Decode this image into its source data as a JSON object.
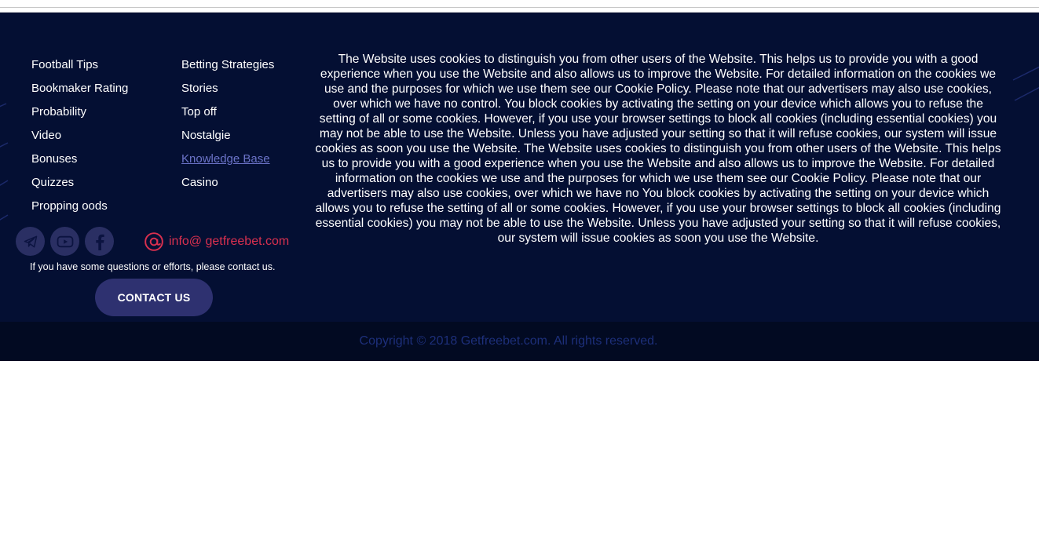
{
  "footer": {
    "links_col1": [
      {
        "label": "Football Tips"
      },
      {
        "label": "Bookmaker Rating"
      },
      {
        "label": "Probability"
      },
      {
        "label": "Video"
      },
      {
        "label": "Bonuses"
      },
      {
        "label": "Quizzes"
      },
      {
        "label": "Propping oods"
      }
    ],
    "links_col2": [
      {
        "label": "Betting Strategies"
      },
      {
        "label": "Stories"
      },
      {
        "label": "Top off"
      },
      {
        "label": "Nostalgie"
      },
      {
        "label": "Knowledge Base",
        "style": "link"
      },
      {
        "label": "Casino"
      }
    ],
    "socials": [
      {
        "icon": "telegram-icon"
      },
      {
        "icon": "youtube-icon"
      },
      {
        "icon": "facebook-icon"
      }
    ],
    "email": {
      "icon": "at-sign-icon",
      "text": "info@ getfreebet.com"
    },
    "contact_text": "If you have some questions or efforts, please contact us.",
    "contact_button": "CONTACT US",
    "cookie_text": "The Website uses cookies to distinguish you from other users of the Website. This helps us to provide you with a good experience when you use the Website and also allows us to improve the Website. For detailed information on the cookies we use and the purposes for which we use them see our Cookie Policy. Please note that our advertisers may also use cookies, over which we have no control. You block cookies by activating the setting on your device which allows you to refuse the setting of all or some cookies. However, if you use your browser settings to block all cookies (including essential cookies) you may not be able to use the Website. Unless you have adjusted your setting so that it will refuse cookies, our system will issue cookies as soon you use the Website. The Website uses cookies to distinguish you from other users of the Website. This helps us to provide you with a good experience when you use the Website and also allows us to improve the Website. For detailed information on the cookies we use and the purposes for which we use them see our Cookie Policy. Please note that our advertisers may also use cookies, over which we have no You block cookies by activating the setting on your device which allows you to refuse the setting of all or some cookies. However, if you use your browser settings to block all cookies (including essential cookies) you may not be able to use the Website. Unless you have adjusted your setting so that it will refuse cookies, our system will issue cookies as soon you use the Website."
  },
  "copyright": "Copyright © 2018 Getfreebet.com. All rights reserved.",
  "colors": {
    "footer_bg": "#040f33",
    "copyright_bg": "#020a22",
    "accent_red": "#d9304f",
    "button_bg": "#2e3170",
    "link": "#6b73c8"
  }
}
